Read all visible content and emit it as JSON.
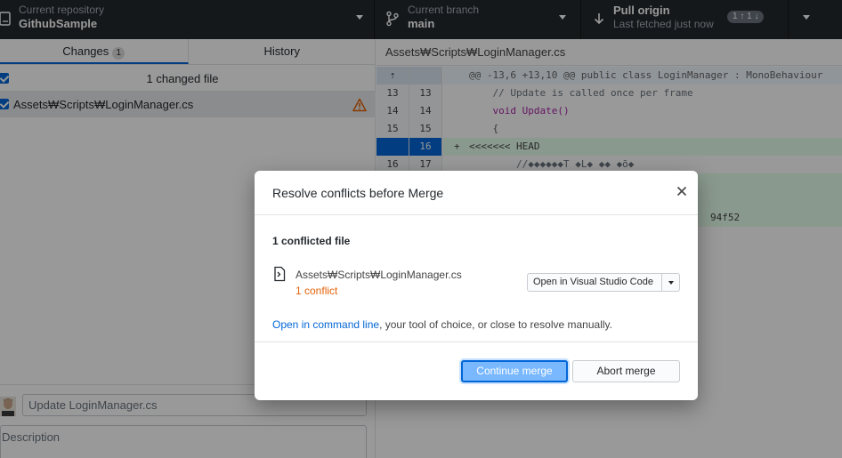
{
  "toolbar": {
    "repo_label": "Current repository",
    "repo_value": "GithubSample",
    "branch_label": "Current branch",
    "branch_value": "main",
    "pull_title": "Pull origin",
    "pull_subtitle": "Last fetched just now",
    "pull_badge": "1 ↑ 1 ↓"
  },
  "left": {
    "tabs": [
      {
        "label": "Changes",
        "count": "1"
      },
      {
        "label": "History"
      }
    ],
    "changed_summary": "1 changed file",
    "files": [
      {
        "path": "Assets₩Scripts₩LoginManager.cs",
        "status_icon": "warning-icon"
      }
    ],
    "commit": {
      "summary_value": "Update LoginManager.cs",
      "description_placeholder": "Description"
    }
  },
  "diff": {
    "file_path": "Assets₩Scripts₩LoginManager.cs",
    "hunk_header": "@@ -13,6 +13,10 @@ public class LoginManager : MonoBehaviour",
    "lines": [
      {
        "old": "13",
        "new": "13",
        "text": "    // Update is called once per frame"
      },
      {
        "old": "14",
        "new": "14",
        "text": "    void Update()"
      },
      {
        "old": "15",
        "new": "15",
        "text": "    {"
      },
      {
        "old": "",
        "new": "16",
        "marker": "+",
        "text": "<<<<<<< HEAD"
      },
      {
        "old": "16",
        "new": "17",
        "text": "        //◆◆◆◆◆◆T ◆L◆ ◆◆ ◆õ◆"
      }
    ],
    "trailing_fragment": "94f52"
  },
  "dialog": {
    "title": "Resolve conflicts before Merge",
    "conflicted_count": "1 conflicted file",
    "file_path": "Assets₩Scripts₩LoginManager.cs",
    "file_conflicts": "1 conflict",
    "open_button": "Open in Visual Studio Code",
    "hint_link": "Open in command line",
    "hint_rest": ", your tool of choice, or close to resolve manually.",
    "continue_button": "Continue merge",
    "abort_button": "Abort merge"
  },
  "colors": {
    "toolbar_bg": "#24292e",
    "accent": "#0366d6",
    "conflict": "#e36209",
    "added_bg": "#e6ffed"
  }
}
